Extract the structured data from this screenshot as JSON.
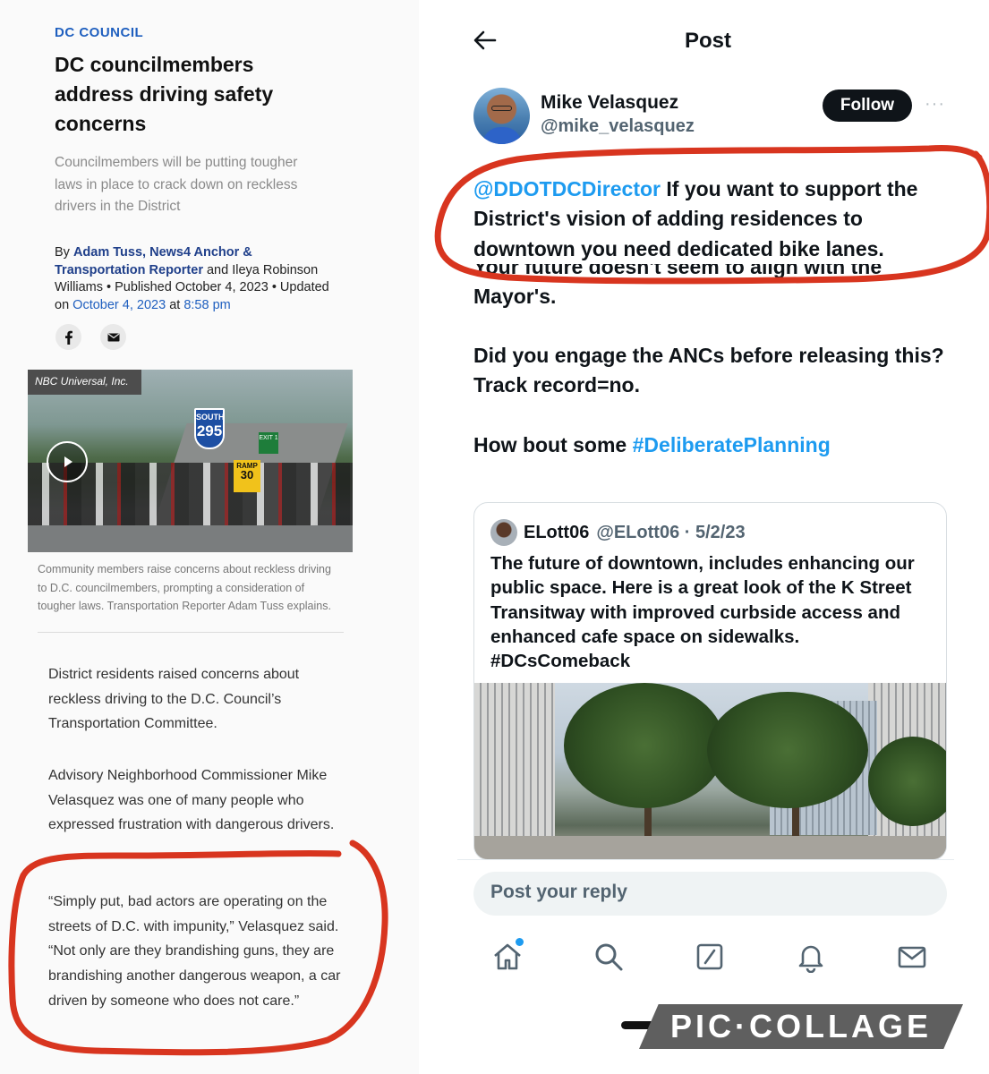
{
  "article": {
    "kicker": "DC COUNCIL",
    "headline": "DC councilmembers address driving safety concerns",
    "dek": "Councilmembers will be putting tougher laws in place to crack down on reckless drivers in the District",
    "byline": {
      "by": "By ",
      "author_link": "Adam Tuss, News4 Anchor & Transportation Reporter",
      "coauthor": " and Ileya Robinson Williams • Published October 4, 2023 • Updated on ",
      "updated_date": "October 4, 2023",
      "at": " at ",
      "updated_time": "8:58 pm"
    },
    "share_icons": [
      "facebook-icon",
      "email-icon"
    ],
    "video": {
      "credit": "NBC Universal, Inc.",
      "shield_top": "SOUTH",
      "shield_number": "295",
      "exit_sign": "EXIT 1",
      "ramp_top": "RAMP",
      "ramp_number": "30"
    },
    "caption": "Community members raise concerns about reckless driving to D.C. councilmembers, prompting a consideration of tougher laws. Transportation Reporter Adam Tuss explains.",
    "paragraphs": [
      "District residents raised concerns about reckless driving to the D.C. Council’s Transportation Committee.",
      "Advisory Neighborhood Commissioner Mike Velasquez was one of many people who expressed frustration with dangerous drivers.",
      "“Simply put, bad actors are operating on the streets of D.C. with impunity,” Velasquez said. “Not only are they brandishing guns, they are brandishing another dangerous weapon, a car driven by someone who does not care.”"
    ]
  },
  "post": {
    "header_title": "Post",
    "user_name": "Mike Velasquez",
    "user_handle": "@mike_velasquez",
    "follow_label": "Follow",
    "more_icon": "···",
    "mention": "@DDOTDCDirector",
    "body_1": " If you want to support the District's vision of adding residences to downtown you need dedicated bike lanes.",
    "body_cut": "Your future doesn't seem to align with the",
    "body_2": "Mayor's.",
    "body_3": "Did you engage the ANCs before releasing this? Track record=no.",
    "body_4_prefix": "How bout some ",
    "hashtag": "#DeliberatePlanning",
    "quote": {
      "name": "ELott06",
      "handle_date": "@ELott06 · 5/2/23",
      "text": "The future of downtown, includes enhancing our public space. Here is a great look of the K Street Transitway with improved curbside access and enhanced cafe space on sidewalks.",
      "hashtag": "#DCsComeback"
    },
    "reply_placeholder": "Post your reply",
    "nav_icons": [
      "home-icon",
      "search-icon",
      "compose-icon",
      "notifications-icon",
      "messages-icon"
    ]
  },
  "watermark": "PIC·COLLAGE",
  "colors": {
    "link_blue": "#1d9bf0",
    "annotation_red": "#d8351f",
    "kicker_blue": "#1f5fbf"
  }
}
